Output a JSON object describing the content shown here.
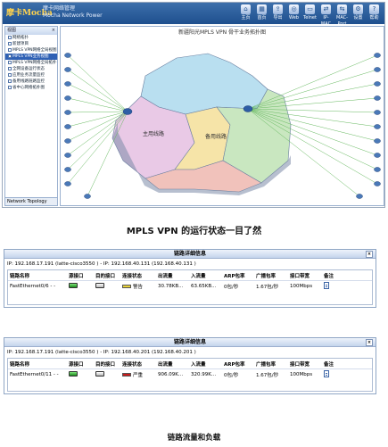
{
  "app": {
    "logo": "摩卡Mocha",
    "subtitle_line1": "摩卡网络管理",
    "subtitle_line2": "Mocha Network Power",
    "toolbar": [
      {
        "label": "主页",
        "icon": "home-icon"
      },
      {
        "label": "首页",
        "icon": "map-icon"
      },
      {
        "label": "导出",
        "icon": "export-icon"
      },
      {
        "label": "Web",
        "icon": "web-icon"
      },
      {
        "label": "Telnet",
        "icon": "telnet-icon"
      },
      {
        "label": "IP-MAC",
        "icon": "ipmac-icon"
      },
      {
        "label": "MAC-Port",
        "icon": "macport-icon"
      },
      {
        "label": "设置",
        "icon": "settings-icon"
      },
      {
        "label": "帮助",
        "icon": "help-icon"
      }
    ],
    "sidebar": {
      "header": "视图",
      "close": "×",
      "items": [
        {
          "label": "网络拓扑",
          "selected": false
        },
        {
          "label": "新建项目",
          "selected": false
        },
        {
          "label": "MPLS VPN网络全局视图",
          "selected": false
        },
        {
          "label": "MPLS VPN业务视图",
          "selected": true
        },
        {
          "label": "MPLS VPN网络全局拓扑",
          "selected": false
        },
        {
          "label": "全网设备运行状态",
          "selected": false
        },
        {
          "label": "应用业务流量监控",
          "selected": false
        },
        {
          "label": "备用线路链路监控",
          "selected": false
        },
        {
          "label": "省中心网络拓扑图",
          "selected": false
        }
      ],
      "footer": "Network Topology"
    },
    "map": {
      "title": "新疆阳光MPLS VPN 骨干业务拓扑图",
      "region_labels": [
        "主用线路",
        "备用线路"
      ]
    }
  },
  "caption_top": "MPLS VPN 的运行状态一目了然",
  "panels": [
    {
      "title": "链路详细信息",
      "close": "×",
      "ip_line": "IP: 192.168.17.191 (latte-cisco3550 ) - IP: 192.168.40.131 (192.168.40.131 )",
      "headers": [
        "链路名称",
        "源接口",
        "目的接口",
        "连接状态",
        "出流量",
        "入流量",
        "ARP包率",
        "广播包率",
        "接口带宽",
        "备注"
      ],
      "row": {
        "name": "FastEthernet0/6 - -",
        "status_text": "警告",
        "status_color": "#e8d23a",
        "out_traffic": "30.78KB...",
        "in_traffic": "63.65KB...",
        "arp_rate": "0包/秒",
        "broadcast_rate": "1.67包/秒",
        "bandwidth": "100Mbps"
      }
    },
    {
      "title": "链路详细信息",
      "close": "×",
      "ip_line": "IP: 192.168.17.191 (latte-cisco3550 ) - IP: 192.168.40.201 (192.168.40.201 )",
      "headers": [
        "链路名称",
        "源接口",
        "目的接口",
        "连接状态",
        "出流量",
        "入流量",
        "ARP包率",
        "广播包率",
        "接口带宽",
        "备注"
      ],
      "row": {
        "name": "FastEthernet0/11 - -",
        "status_text": "严重",
        "status_color": "#c81d1d",
        "out_traffic": "906.09K...",
        "in_traffic": "320.99K...",
        "arp_rate": "0包/秒",
        "broadcast_rate": "1.67包/秒",
        "bandwidth": "100Mbps"
      }
    }
  ],
  "caption_bottom": "链路流量和负载"
}
